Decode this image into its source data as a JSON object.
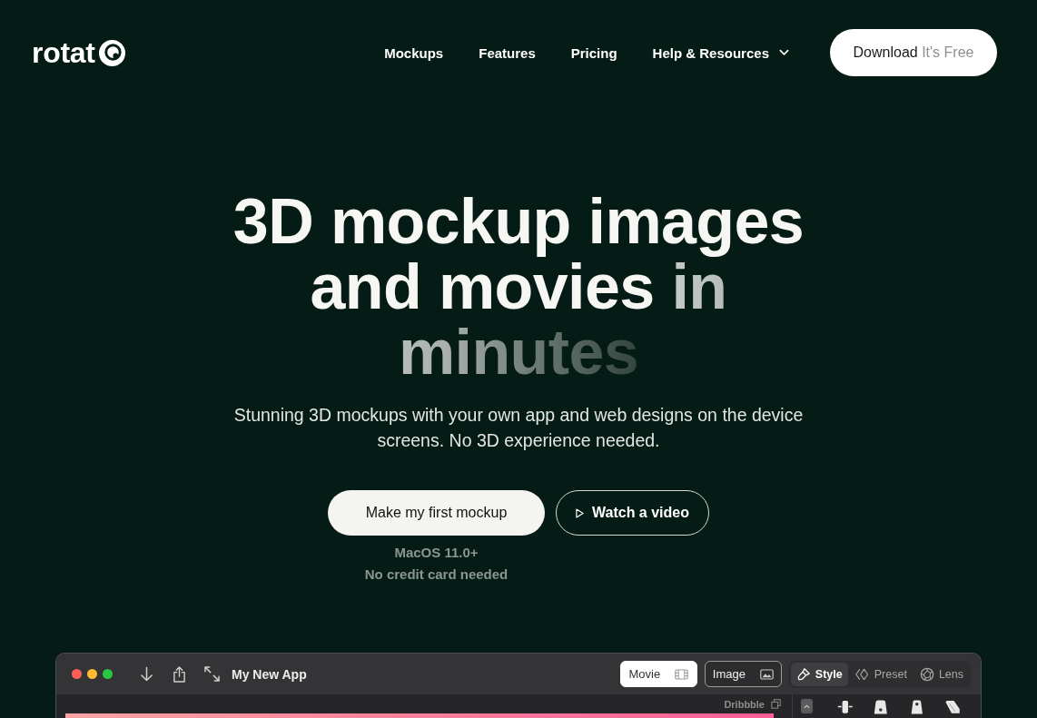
{
  "nav": {
    "logo": {
      "text": "rotat"
    },
    "links": [
      {
        "label": "Mockups",
        "dropdown": false
      },
      {
        "label": "Features",
        "dropdown": false
      },
      {
        "label": "Pricing",
        "dropdown": false
      },
      {
        "label": "Help & Resources",
        "dropdown": true
      }
    ],
    "cta": {
      "label": "Download",
      "note": "It's Free"
    }
  },
  "hero": {
    "headline": {
      "lead": "3D mockup images and movies",
      "fade": "in minutes"
    },
    "subtitle": "Stunning 3D mockups with your own app and web designs on the device screens. No 3D experience needed.",
    "primary_button": {
      "label": "Make my first mockup",
      "notes": [
        "MacOS 11.0+",
        "No credit card needed"
      ]
    },
    "secondary_button": {
      "label": "Watch a video"
    }
  },
  "app_window": {
    "title": "My New App",
    "mode_tabs": [
      {
        "label": "Movie",
        "selected": true
      },
      {
        "label": "Image",
        "selected": false
      }
    ],
    "panel_tabs": [
      {
        "label": "Style",
        "selected": true
      },
      {
        "label": "Preset",
        "selected": false
      },
      {
        "label": "Lens",
        "selected": false
      }
    ],
    "canvas_label": "Dribbble"
  }
}
